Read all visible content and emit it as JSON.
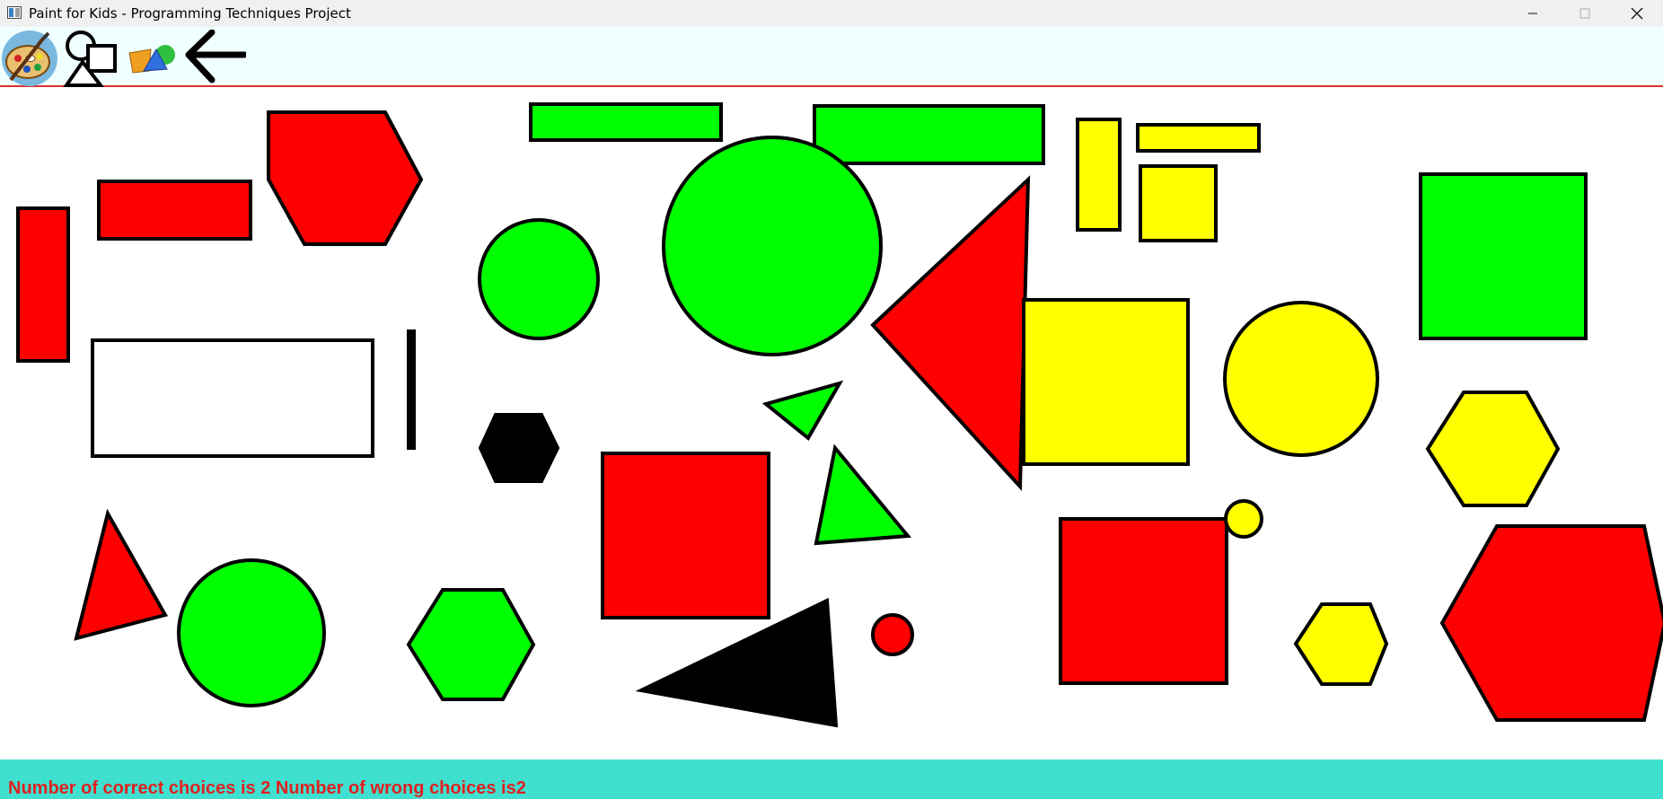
{
  "window": {
    "title": "Paint for Kids - Programming Techniques Project",
    "controls": [
      "minimize-icon",
      "maximize-icon",
      "close-icon"
    ]
  },
  "toolbar": {
    "tools": [
      {
        "name": "draw-mode-palette-icon"
      },
      {
        "name": "shapes-icon"
      },
      {
        "name": "play-mode-shapes-icon"
      },
      {
        "name": "back-arrow-icon"
      }
    ]
  },
  "status": {
    "text": "Number of correct choices is 2 Number of wrong choices is2"
  },
  "colors": {
    "red": "#ff0000",
    "green": "#00ff00",
    "yellow": "#ffff00",
    "black": "#000000",
    "white": "#ffffff",
    "toolbar_bg": "#f0ffff",
    "status_bg": "#40e0d0",
    "status_text": "#e02020"
  },
  "shapes": [
    {
      "type": "rectangle",
      "fill": "red"
    },
    {
      "type": "rectangle",
      "fill": "red"
    },
    {
      "type": "hexagon",
      "fill": "red"
    },
    {
      "type": "rectangle",
      "fill": "green"
    },
    {
      "type": "rectangle",
      "fill": "green"
    },
    {
      "type": "circle",
      "fill": "green"
    },
    {
      "type": "circle",
      "fill": "green"
    },
    {
      "type": "triangle",
      "fill": "red"
    },
    {
      "type": "rectangle",
      "fill": "yellow"
    },
    {
      "type": "rectangle",
      "fill": "yellow"
    },
    {
      "type": "square",
      "fill": "yellow"
    },
    {
      "type": "square",
      "fill": "green"
    },
    {
      "type": "rectangle",
      "fill": "white"
    },
    {
      "type": "line",
      "fill": "black"
    },
    {
      "type": "hexagon",
      "fill": "black"
    },
    {
      "type": "triangle",
      "fill": "green"
    },
    {
      "type": "square",
      "fill": "yellow"
    },
    {
      "type": "circle",
      "fill": "yellow"
    },
    {
      "type": "hexagon",
      "fill": "yellow"
    },
    {
      "type": "square",
      "fill": "red"
    },
    {
      "type": "triangle",
      "fill": "green"
    },
    {
      "type": "triangle",
      "fill": "red"
    },
    {
      "type": "circle",
      "fill": "green"
    },
    {
      "type": "hexagon",
      "fill": "green"
    },
    {
      "type": "triangle",
      "fill": "black"
    },
    {
      "type": "circle",
      "fill": "red"
    },
    {
      "type": "square",
      "fill": "red"
    },
    {
      "type": "circle",
      "fill": "yellow"
    },
    {
      "type": "hexagon",
      "fill": "yellow"
    },
    {
      "type": "hexagon",
      "fill": "red"
    }
  ]
}
